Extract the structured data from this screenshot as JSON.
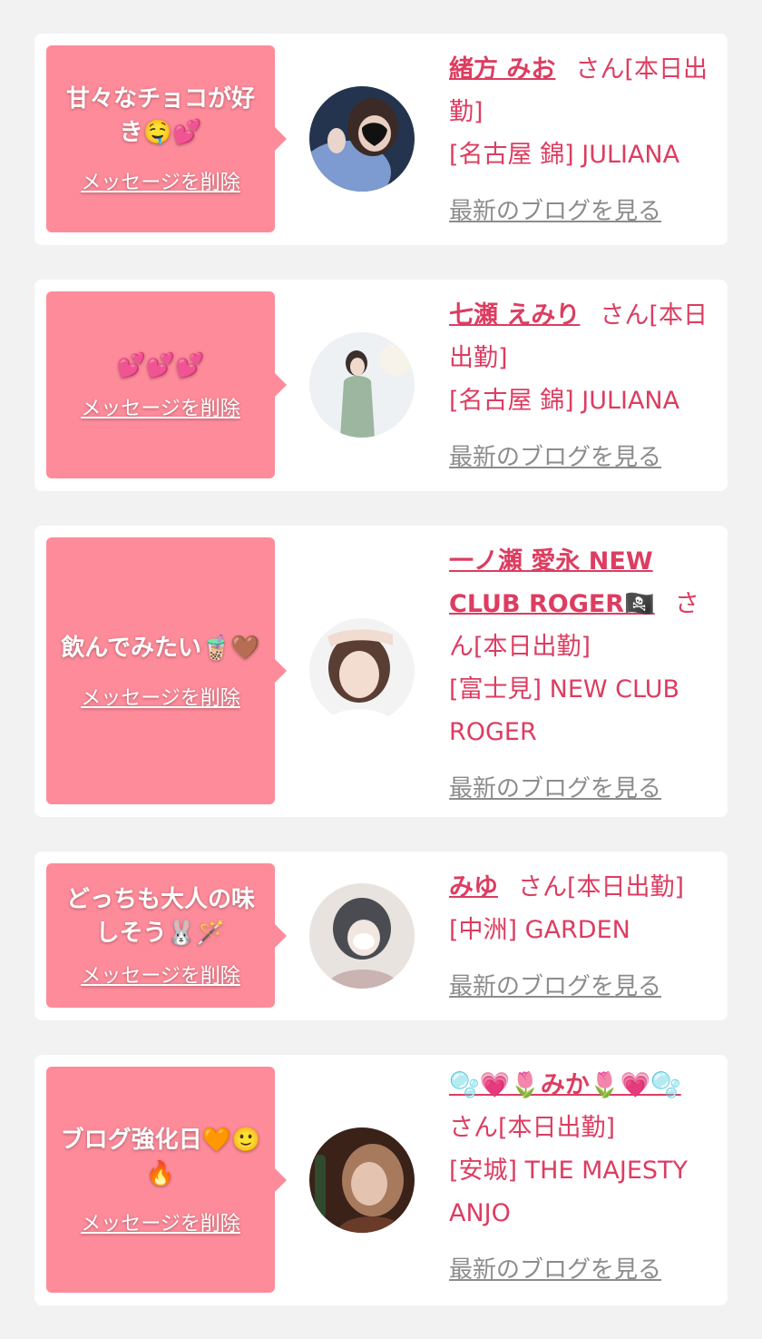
{
  "delete_label": "メッセージを削除",
  "blog_label": "最新のブログを見る",
  "items": [
    {
      "message": "甘々なチョコが好き🤤💕",
      "name": "緒方 みお",
      "suffix": "さん[本日出勤]",
      "shop": "[名古屋 錦] JULIANA"
    },
    {
      "message": "💕💕💕",
      "name": "七瀬 えみり",
      "suffix": "さん[本日出勤]",
      "shop": "[名古屋 錦] JULIANA"
    },
    {
      "message": "飲んでみたい🧋🤎",
      "name": "一ノ瀬 愛永 NEW CLUB ROGER🏴‍☠️",
      "suffix": "さん[本日出勤]",
      "shop": "[富士見] NEW CLUB ROGER"
    },
    {
      "message": "どっちも大人の味しそう🐰🪄",
      "name": "みゆ",
      "suffix": "さん[本日出勤]",
      "shop": "[中洲] GARDEN"
    },
    {
      "message": "ブログ強化日🧡🙂🔥",
      "name": "🫧💗🌷みか🌷💗🫧",
      "suffix": "さん[本日出勤]",
      "shop": "[安城] THE MAJESTY ANJO"
    }
  ],
  "colors": {
    "page_bg": "#f2f2f2",
    "bubble": "#fe8b9a",
    "accent": "#dc3d61",
    "link_gray": "#8c8c8c"
  }
}
